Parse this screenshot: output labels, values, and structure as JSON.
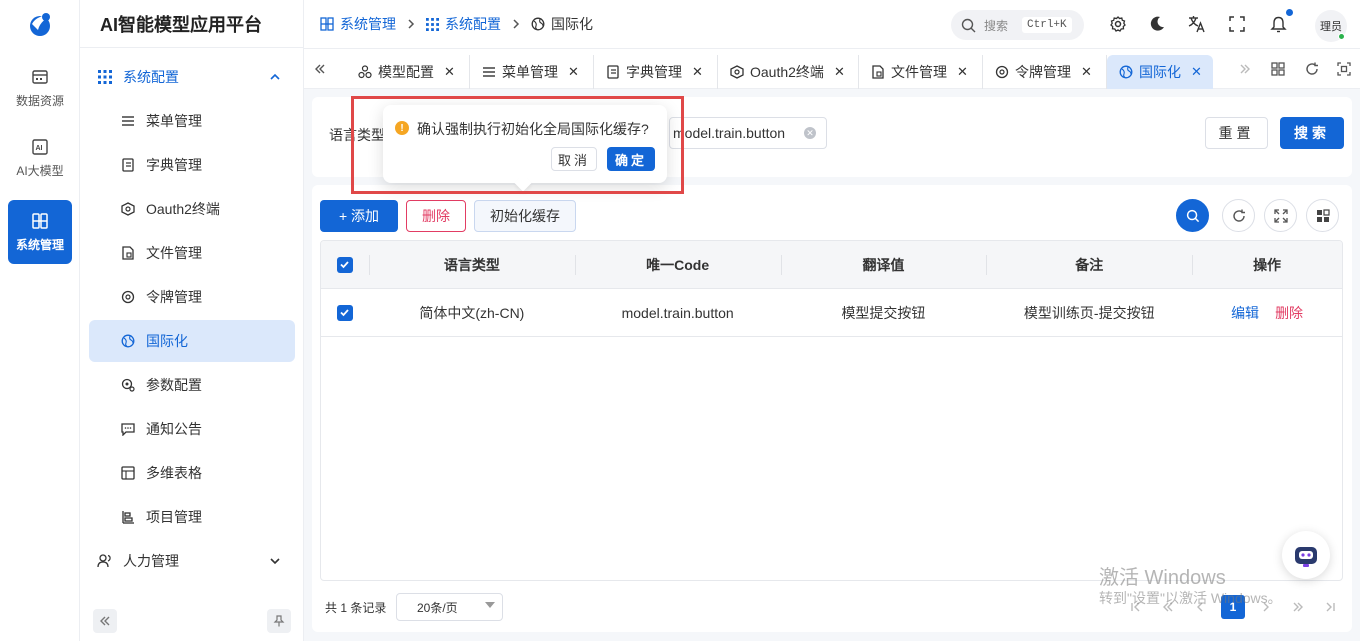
{
  "rail": {
    "items": [
      {
        "label": "数据资源",
        "icon": "database-icon"
      },
      {
        "label": "AI大模型",
        "icon": "ai-icon"
      },
      {
        "label": "系统管理",
        "icon": "system-icon"
      }
    ]
  },
  "sidebar": {
    "title": "AI智能模型应用平台",
    "group": "系统配置",
    "items": [
      {
        "label": "菜单管理",
        "icon": "menu-list-icon"
      },
      {
        "label": "字典管理",
        "icon": "dictionary-icon"
      },
      {
        "label": "Oauth2终端",
        "icon": "oauth-icon"
      },
      {
        "label": "文件管理",
        "icon": "file-icon"
      },
      {
        "label": "令牌管理",
        "icon": "token-icon"
      },
      {
        "label": "国际化",
        "icon": "globe-icon"
      },
      {
        "label": "参数配置",
        "icon": "params-icon"
      },
      {
        "label": "通知公告",
        "icon": "notice-icon"
      },
      {
        "label": "多维表格",
        "icon": "table-icon"
      },
      {
        "label": "项目管理",
        "icon": "project-icon"
      }
    ],
    "group2": "人力管理"
  },
  "header": {
    "breadcrumb": [
      "系统管理",
      "系统配置",
      "国际化"
    ],
    "search_placeholder": "搜索",
    "search_shortcut": "Ctrl+K",
    "avatar_text": "理员"
  },
  "tabs": [
    {
      "label": "模型配置",
      "icon": "model-icon"
    },
    {
      "label": "菜单管理",
      "icon": "menu-list-icon"
    },
    {
      "label": "字典管理",
      "icon": "dictionary-icon"
    },
    {
      "label": "Oauth2终端",
      "icon": "oauth-icon"
    },
    {
      "label": "文件管理",
      "icon": "file-icon"
    },
    {
      "label": "令牌管理",
      "icon": "token-icon"
    },
    {
      "label": "国际化",
      "icon": "globe-icon"
    }
  ],
  "filter": {
    "lang_label": "语言类型",
    "code_value": "model.train.button",
    "reset_label": "重置",
    "search_label": "搜索"
  },
  "toolbar": {
    "add_label": "+ 添加",
    "delete_label": "删除",
    "init_label": "初始化缓存"
  },
  "table": {
    "columns": [
      "语言类型",
      "唯一Code",
      "翻译值",
      "备注",
      "操作"
    ],
    "rows": [
      {
        "lang": "简体中文(zh-CN)",
        "code": "model.train.button",
        "value": "模型提交按钮",
        "remark": "模型训练页-提交按钮",
        "edit": "编辑",
        "delete": "删除",
        "checked": true
      }
    ]
  },
  "pagination": {
    "total_text": "共 1 条记录",
    "page_size": "20条/页",
    "current_page": "1"
  },
  "popconfirm": {
    "message": "确认强制执行初始化全局国际化缓存?",
    "cancel": "取消",
    "ok": "确定"
  },
  "watermark": {
    "line1": "激活 Windows",
    "line2": "转到\"设置\"以激活 Windows。"
  },
  "colors": {
    "primary": "#1366d6",
    "danger": "#e23c63",
    "warning": "#f5a623"
  }
}
